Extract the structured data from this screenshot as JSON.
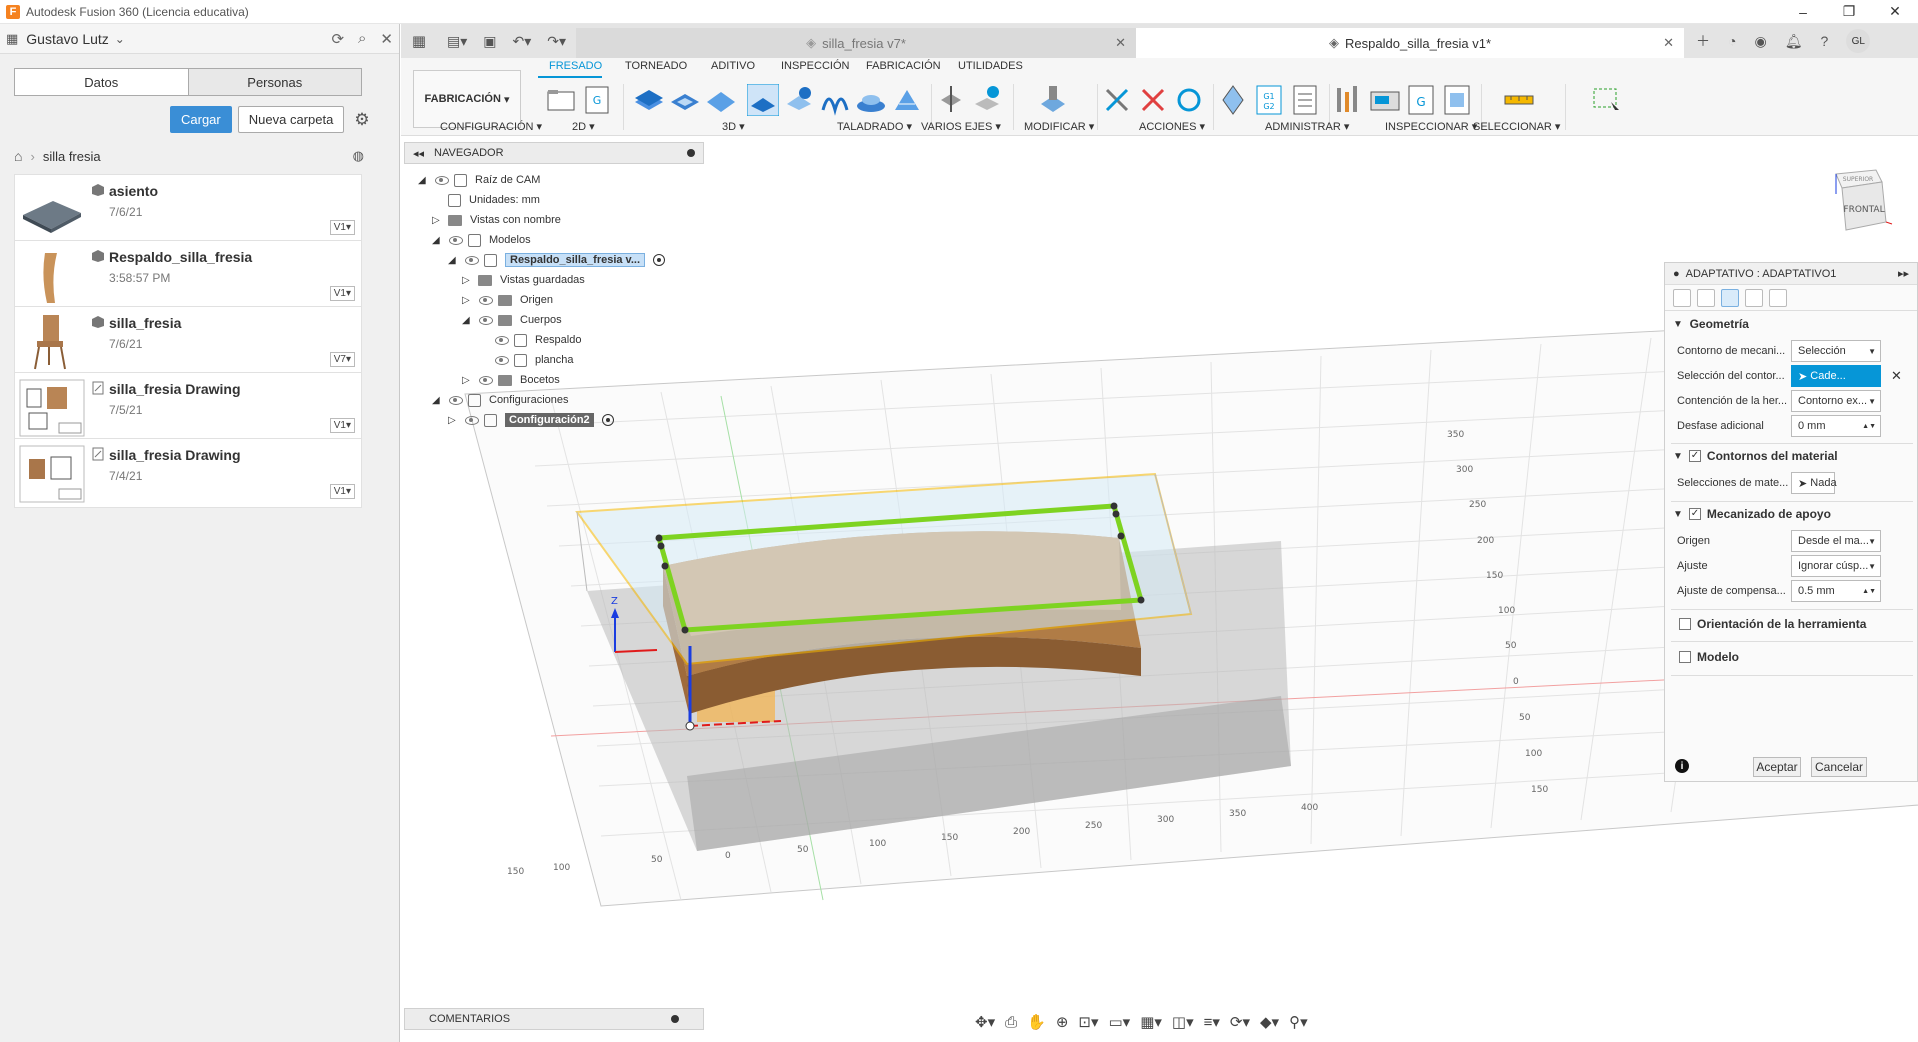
{
  "window": {
    "title": "Autodesk Fusion 360 (Licencia educativa)",
    "app_icon_letter": "F"
  },
  "data_panel": {
    "user": "Gustavo Lutz",
    "tabs": [
      "Datos",
      "Personas"
    ],
    "upload_label": "Cargar",
    "new_folder_label": "Nueva carpeta",
    "breadcrumb": "silla fresia",
    "files": [
      {
        "name": "asiento",
        "date": "7/6/21",
        "version": "V1"
      },
      {
        "name": "Respaldo_silla_fresia",
        "date": "3:58:57 PM",
        "version": "V1"
      },
      {
        "name": "silla_fresia",
        "date": "7/6/21",
        "version": "V7"
      },
      {
        "name": "silla_fresia Drawing",
        "date": "7/5/21",
        "version": "V1"
      },
      {
        "name": "silla_fresia Drawing",
        "date": "7/4/21",
        "version": "V1"
      }
    ]
  },
  "doc_tabs": [
    {
      "label": "silla_fresia v7*",
      "active": false
    },
    {
      "label": "Respaldo_silla_fresia v1*",
      "active": true
    }
  ],
  "user_initials": "GL",
  "ribbon": {
    "workspace": "FABRICACIÓN",
    "tabs": [
      "FRESADO",
      "TORNEADO",
      "ADITIVO",
      "INSPECCIÓN",
      "FABRICACIÓN",
      "UTILIDADES"
    ],
    "groups": [
      "CONFIGURACIÓN",
      "2D",
      "3D",
      "TALADRADO",
      "VARIOS EJES",
      "MODIFICAR",
      "ACCIONES",
      "ADMINISTRAR",
      "INSPECCIONAR",
      "SELECCIONAR"
    ]
  },
  "browser": {
    "title": "NAVEGADOR",
    "rows": [
      {
        "label": "Raíz de CAM"
      },
      {
        "label": "Unidades: mm"
      },
      {
        "label": "Vistas con nombre"
      },
      {
        "label": "Modelos"
      },
      {
        "label": "Respaldo_silla_fresia v..."
      },
      {
        "label": "Vistas guardadas"
      },
      {
        "label": "Origen"
      },
      {
        "label": "Cuerpos"
      },
      {
        "label": "Respaldo"
      },
      {
        "label": "plancha"
      },
      {
        "label": "Bocetos"
      },
      {
        "label": "Configuraciones"
      },
      {
        "label": "Configuración2"
      }
    ]
  },
  "comments_label": "COMENTARIOS",
  "viewcube": {
    "face": "FRONTAL",
    "top": "SUPERIOR"
  },
  "dialog": {
    "title": "ADAPTATIVO : ADAPTATIVO1",
    "sections": {
      "geometry": "Geometría",
      "stock_contours": "Contornos del material",
      "rest_machining": "Mecanizado de apoyo",
      "tool_orientation": "Orientación de la herramienta",
      "model": "Modelo"
    },
    "fields": {
      "machining_boundary": {
        "label": "Contorno de mecani...",
        "value": "Selección"
      },
      "boundary_selection": {
        "label": "Selección del contor...",
        "value": "Cade..."
      },
      "tool_containment": {
        "label": "Contención de la her...",
        "value": "Contorno ex..."
      },
      "additional_offset": {
        "label": "Desfase adicional",
        "value": "0 mm"
      },
      "stock_selections": {
        "label": "Selecciones de mate...",
        "value": "Nada"
      },
      "source": {
        "label": "Origen",
        "value": "Desde el ma..."
      },
      "adjustment": {
        "label": "Ajuste",
        "value": "Ignorar cúsp..."
      },
      "adjustment_offset": {
        "label": "Ajuste de compensa...",
        "value": "0.5 mm"
      }
    },
    "ok_label": "Aceptar",
    "cancel_label": "Cancelar"
  },
  "grid_labels": {
    "right": [
      "350",
      "300",
      "250",
      "200",
      "150",
      "100",
      "50",
      "0",
      "50",
      "100",
      "150"
    ],
    "bottom": [
      "150",
      "100",
      "50",
      "0",
      "50",
      "100",
      "150",
      "200",
      "250",
      "300",
      "350",
      "400"
    ]
  },
  "axis_label": "Z",
  "colors": {
    "accent": "#0696d7",
    "toolpath": "#7ed321",
    "stock_box": "#f5b800",
    "wood": "#c9935a"
  }
}
